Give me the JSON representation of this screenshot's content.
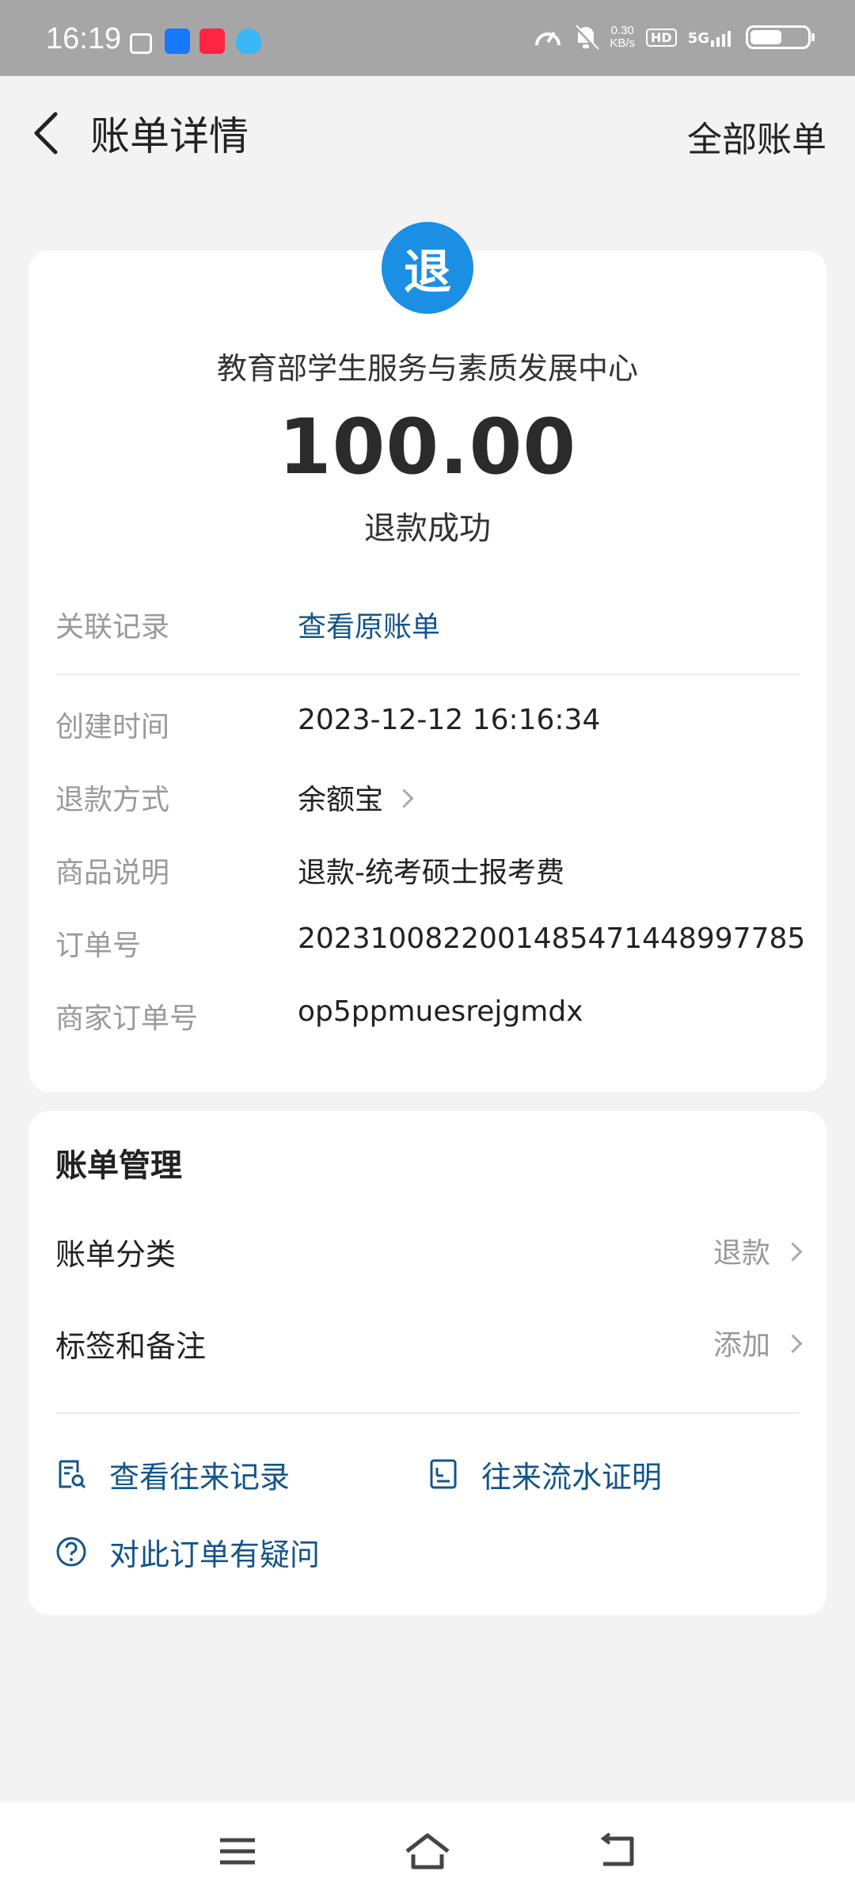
{
  "status_bar": {
    "time": "16:19",
    "net_speed_value": "0.30",
    "net_speed_unit": "KB/s",
    "hd": "HD",
    "signal": "5G",
    "battery_level": 0.56
  },
  "header": {
    "title": "账单详情",
    "all_bills": "全部账单"
  },
  "bill": {
    "icon_text": "退",
    "merchant": "教育部学生服务与素质发展中心",
    "amount": "100.00",
    "status": "退款成功",
    "related_label": "关联记录",
    "related_value": "查看原账单",
    "details": [
      {
        "label": "创建时间",
        "value": "2023-12-12 16:16:34"
      },
      {
        "label": "退款方式",
        "value": "余额宝"
      },
      {
        "label": "商品说明",
        "value": "退款-统考硕士报考费"
      },
      {
        "label": "订单号",
        "value": "2023100822001485471448997785"
      },
      {
        "label": "商家订单号",
        "value": "op5ppmuesrejgmdx"
      }
    ]
  },
  "management": {
    "title": "账单管理",
    "category_label": "账单分类",
    "category_value": "退款",
    "tags_label": "标签和备注",
    "tags_value": "添加",
    "history": "查看往来记录",
    "proof": "往来流水证明",
    "question": "对此订单有疑问"
  },
  "colors": {
    "accent_blue": "#1a8fe3",
    "link": "#14558a",
    "status_bar_bg": "#a6a6a6"
  }
}
